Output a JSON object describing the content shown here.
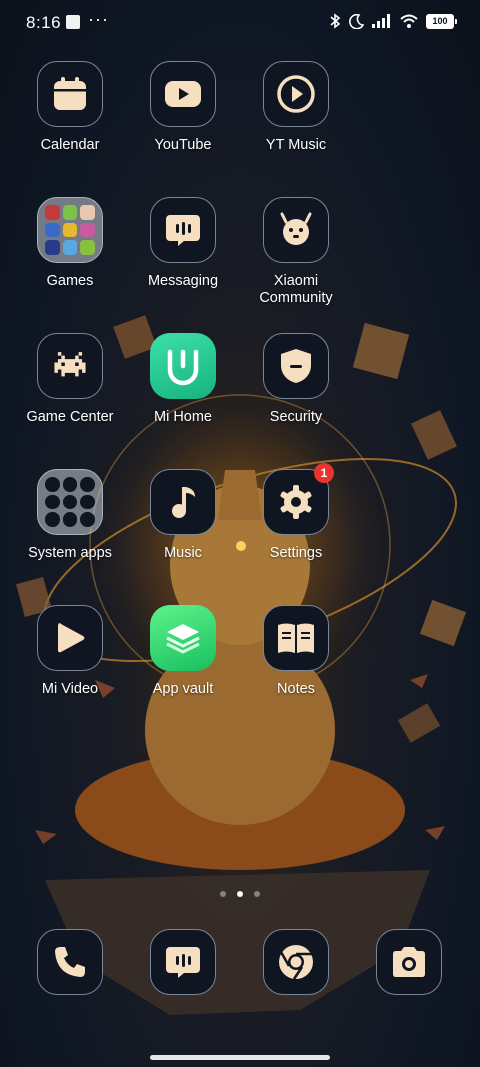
{
  "status_bar": {
    "time": "8:16",
    "dots": "···",
    "battery": "100"
  },
  "apps": {
    "calendar": "Calendar",
    "youtube": "YouTube",
    "yt_music": "YT Music",
    "games": "Games",
    "messaging": "Messaging",
    "xiaomi_community": "Xiaomi Community",
    "game_center": "Game Center",
    "mi_home": "Mi Home",
    "security": "Security",
    "system_apps": "System apps",
    "music": "Music",
    "settings": "Settings",
    "settings_badge": "1",
    "mi_video": "Mi Video",
    "app_vault": "App vault",
    "notes": "Notes"
  },
  "colors": {
    "icon_glyph": "#f6dfc0",
    "badge": "#e8362c"
  }
}
